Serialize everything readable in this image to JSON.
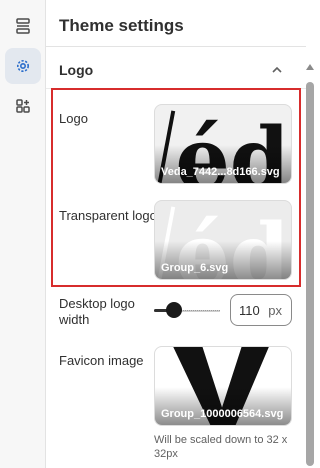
{
  "panel": {
    "title": "Theme settings"
  },
  "rail": {
    "items": [
      {
        "icon": "sections-icon",
        "active": false
      },
      {
        "icon": "gear-icon",
        "active": true
      },
      {
        "icon": "apps-icon",
        "active": false
      }
    ]
  },
  "section": {
    "title": "Logo"
  },
  "logo": {
    "label": "Logo",
    "file": "Veda_7442...8d166.svg"
  },
  "transparent_logo": {
    "label": "Transparent logo",
    "file": "Group_6.svg"
  },
  "desktop_width": {
    "label": "Desktop logo width",
    "value": "110",
    "unit": "px",
    "slider_fraction": 0.2
  },
  "favicon": {
    "label": "Favicon image",
    "file": "Group_1000006564.svg",
    "hint": "Will be scaled down to 32 x 32px"
  },
  "colors": {
    "highlight": "#d72c2c",
    "accent": "#2c6ecb"
  }
}
